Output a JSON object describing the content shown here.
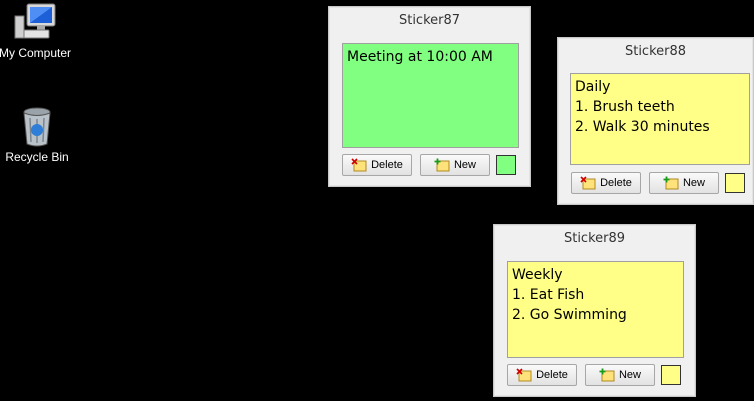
{
  "desktop": {
    "icons": [
      {
        "label": "My Computer",
        "icon": "computer-icon"
      },
      {
        "label": "Recycle Bin",
        "icon": "recycle-bin-icon"
      }
    ]
  },
  "stickers": [
    {
      "title": "Sticker87",
      "text": "Meeting at 10:00 AM",
      "color": "#80ff80",
      "delete_label": "Delete",
      "new_label": "New"
    },
    {
      "title": "Sticker88",
      "text": "Daily\n1. Brush teeth\n2. Walk 30 minutes",
      "color": "#ffff88",
      "delete_label": "Delete",
      "new_label": "New"
    },
    {
      "title": "Sticker89",
      "text": "Weekly\n1. Eat Fish\n2. Go Swimming",
      "color": "#ffff88",
      "delete_label": "Delete",
      "new_label": "New"
    }
  ]
}
